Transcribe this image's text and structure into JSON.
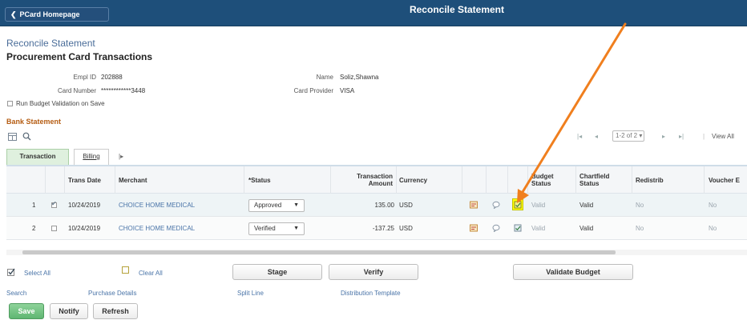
{
  "header": {
    "home_label": "PCard Homepage",
    "title": "Reconcile Statement"
  },
  "page": {
    "breadcrumb": "Reconcile Statement",
    "heading": "Procurement Card Transactions"
  },
  "info": {
    "empl_id_label": "Empl ID",
    "empl_id": "202888",
    "card_number_label": "Card Number",
    "card_number": "************3448",
    "name_label": "Name",
    "name": "Soliz,Shawna",
    "card_provider_label": "Card Provider",
    "card_provider": "VISA",
    "run_budget_label": "Run Budget Validation on Save"
  },
  "bank_statement": {
    "title": "Bank Statement",
    "pager": {
      "first": "|◂",
      "prev": "◂",
      "range": "1-2 of 2",
      "next": "▸",
      "last": "▸|",
      "view_all": "View All"
    },
    "tabs": {
      "transaction": "Transaction",
      "billing": "Billing",
      "more": "|▸"
    },
    "columns": {
      "trans_date": "Trans Date",
      "merchant": "Merchant",
      "status": "*Status",
      "amount": "Transaction Amount",
      "currency": "Currency",
      "budget_status": "Budget Status",
      "chartfield_status": "Chartfield Status",
      "redistrib": "Redistrib",
      "voucher": "Voucher E"
    },
    "rows": [
      {
        "num": "1",
        "checked": true,
        "trans_date": "10/24/2019",
        "merchant": "CHOICE HOME MEDICAL",
        "status": "Approved",
        "amount": "135.00",
        "currency": "USD",
        "budget_status": "Valid",
        "chartfield_status": "Valid",
        "redistrib": "No",
        "voucher": "No"
      },
      {
        "num": "2",
        "checked": false,
        "trans_date": "10/24/2019",
        "merchant": "CHOICE HOME MEDICAL",
        "status": "Verified",
        "amount": "-137.25",
        "currency": "USD",
        "budget_status": "Valid",
        "chartfield_status": "Valid",
        "redistrib": "No",
        "voucher": "No"
      }
    ]
  },
  "actions": {
    "select_all": "Select All",
    "clear_all": "Clear All",
    "stage": "Stage",
    "verify": "Verify",
    "validate_budget": "Validate Budget"
  },
  "links": {
    "search": "Search",
    "purchase_details": "Purchase Details",
    "split_line": "Split Line",
    "distribution_template": "Distribution Template"
  },
  "footer": {
    "save": "Save",
    "notify": "Notify",
    "refresh": "Refresh"
  },
  "colors": {
    "topbar": "#1e4f7a",
    "link": "#4a74a8",
    "section_orange": "#b55c12",
    "annotation_arrow": "#f07f1e",
    "highlight": "#ffff00",
    "save_green": "#5fb672"
  }
}
